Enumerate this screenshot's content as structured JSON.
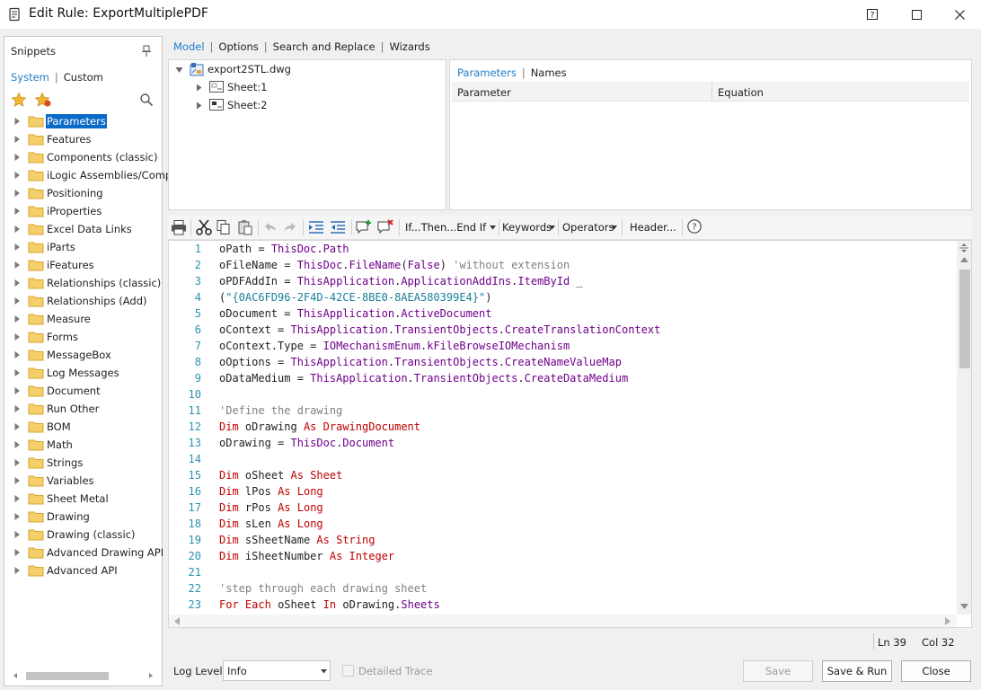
{
  "window": {
    "title": "Edit Rule: ExportMultiplePDF"
  },
  "snippets": {
    "header": "Snippets",
    "tabs": [
      "System",
      "Custom"
    ],
    "items": [
      "Parameters",
      "Features",
      "Components (classic)",
      "iLogic Assemblies/Compon",
      "Positioning",
      "iProperties",
      "Excel Data Links",
      "iParts",
      "iFeatures",
      "Relationships (classic)",
      "Relationships (Add)",
      "Measure",
      "Forms",
      "MessageBox",
      "Log Messages",
      "Document",
      "Run Other",
      "BOM",
      "Math",
      "Strings",
      "Variables",
      "Sheet Metal",
      "Drawing",
      "Drawing (classic)",
      "Advanced Drawing API",
      "Advanced API"
    ],
    "selected": "Parameters"
  },
  "main_tabs": [
    "Model",
    "Options",
    "Search and Replace",
    "Wizards"
  ],
  "model_tree": {
    "root": "export2STL.dwg",
    "children": [
      "Sheet:1",
      "Sheet:2"
    ]
  },
  "param_tabs": [
    "Parameters",
    "Names"
  ],
  "param_columns": [
    "Parameter",
    "Equation"
  ],
  "toolbar": {
    "ifthen": "If...Then...End If",
    "keywords": "Keywords",
    "operators": "Operators",
    "header": "Header..."
  },
  "code": {
    "line_numbers": [
      "1",
      "2",
      "3",
      "4",
      "5",
      "6",
      "7",
      "8",
      "9",
      "10",
      "11",
      "12",
      "13",
      "14",
      "15",
      "16",
      "17",
      "18",
      "19",
      "20",
      "21",
      "22",
      "23"
    ],
    "lines": [
      "oPath = ThisDoc.Path",
      "oFileName = ThisDoc.FileName(False) 'without extension",
      "oPDFAddIn = ThisApplication.ApplicationAddIns.ItemById _",
      "(\"{0AC6FD96-2F4D-42CE-8BE0-8AEA580399E4}\")",
      "oDocument = ThisApplication.ActiveDocument",
      "oContext = ThisApplication.TransientObjects.CreateTranslationContext",
      "oContext.Type = IOMechanismEnum.kFileBrowseIOMechanism",
      "oOptions = ThisApplication.TransientObjects.CreateNameValueMap",
      "oDataMedium = ThisApplication.TransientObjects.CreateDataMedium",
      "",
      "'Define the drawing",
      "Dim oDrawing As DrawingDocument",
      "oDrawing = ThisDoc.Document",
      "",
      "Dim oSheet As Sheet",
      "Dim lPos As Long",
      "Dim rPos As Long",
      "Dim sLen As Long",
      "Dim sSheetName As String",
      "Dim iSheetNumber As Integer",
      "",
      "'step through each drawing sheet",
      "For Each oSheet In oDrawing.Sheets"
    ]
  },
  "status": {
    "line": "Ln 39",
    "col": "Col 32"
  },
  "bottom": {
    "log_level_label": "Log Level",
    "log_level_value": "Info",
    "detailed_trace": "Detailed Trace",
    "save": "Save",
    "save_run": "Save & Run",
    "close": "Close"
  }
}
